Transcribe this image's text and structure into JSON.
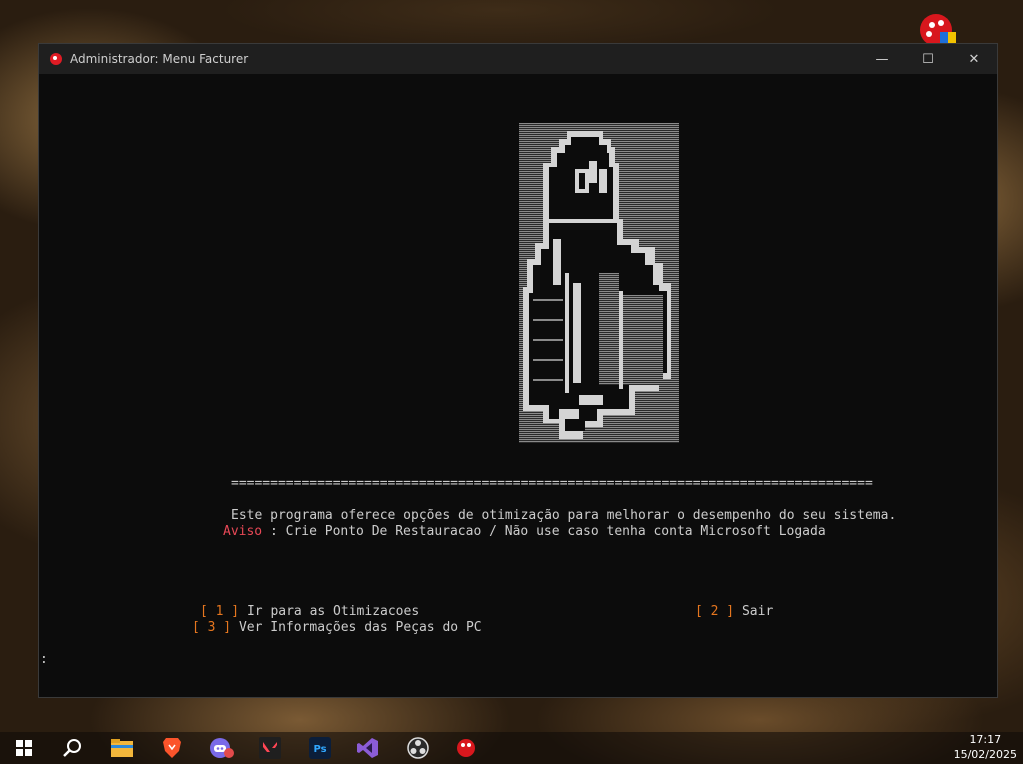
{
  "window": {
    "title": "Administrador:  Menu Facturer",
    "controls": {
      "minimize": "—",
      "maximize": "☐",
      "close": "✕"
    }
  },
  "console": {
    "separator": "==================================================================================",
    "description": "Este programa oferece opções de otimização para melhorar o desempenho do seu sistema.",
    "warning_label": "Aviso",
    "warning_text": " : Crie Ponto De Restauracao / Não use caso tenha conta Microsoft Logada",
    "options": [
      {
        "bracket": "[ 1 ]",
        "label": " Ir para as Otimizacoes"
      },
      {
        "bracket": "[ 2 ]",
        "label": " Sair"
      },
      {
        "bracket": "[ 3 ]",
        "label": " Ver Informações das Peças do PC"
      }
    ],
    "prompt": ":"
  },
  "taskbar": {
    "icons": [
      "windows-start-icon",
      "search-icon",
      "file-explorer-icon",
      "brave-browser-icon",
      "discord-icon",
      "valorant-icon",
      "photoshop-icon",
      "visual-studio-icon",
      "obs-icon",
      "facturer-app-icon"
    ],
    "photoshop_label": "Ps",
    "time": "17:17",
    "date": "15/02/2025"
  },
  "colors": {
    "accent_orange": "#e5761f",
    "warning_red": "#e74856",
    "console_bg": "#0c0c0c",
    "text": "#cccccc"
  }
}
